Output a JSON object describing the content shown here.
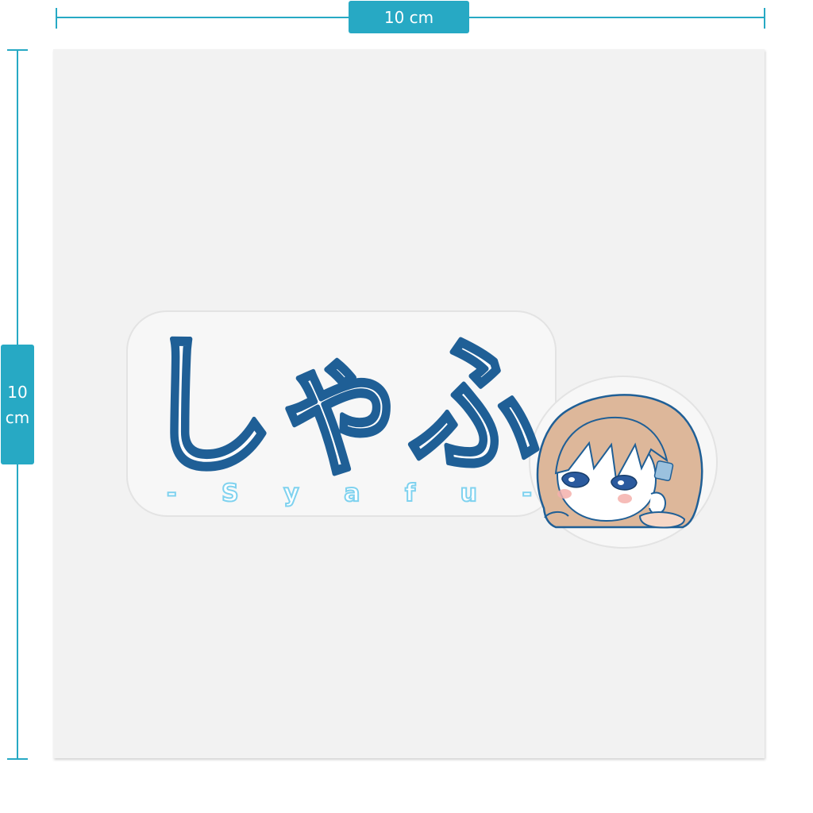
{
  "dimensions": {
    "width_label": "10 cm",
    "height_value": "10",
    "height_unit": "cm"
  },
  "sticker": {
    "title": "しゃふ",
    "subtitle": "- S y a f u -"
  },
  "colors": {
    "accent": "#27a9c4",
    "sheet": "#f2f2f2",
    "title_outline": "#1f5f96",
    "subtitle": "#7fd2ef",
    "hair": "#ddb79a",
    "eyes": "#2b5a9e"
  },
  "icons": {
    "character": "chibi-girl-head-icon"
  }
}
